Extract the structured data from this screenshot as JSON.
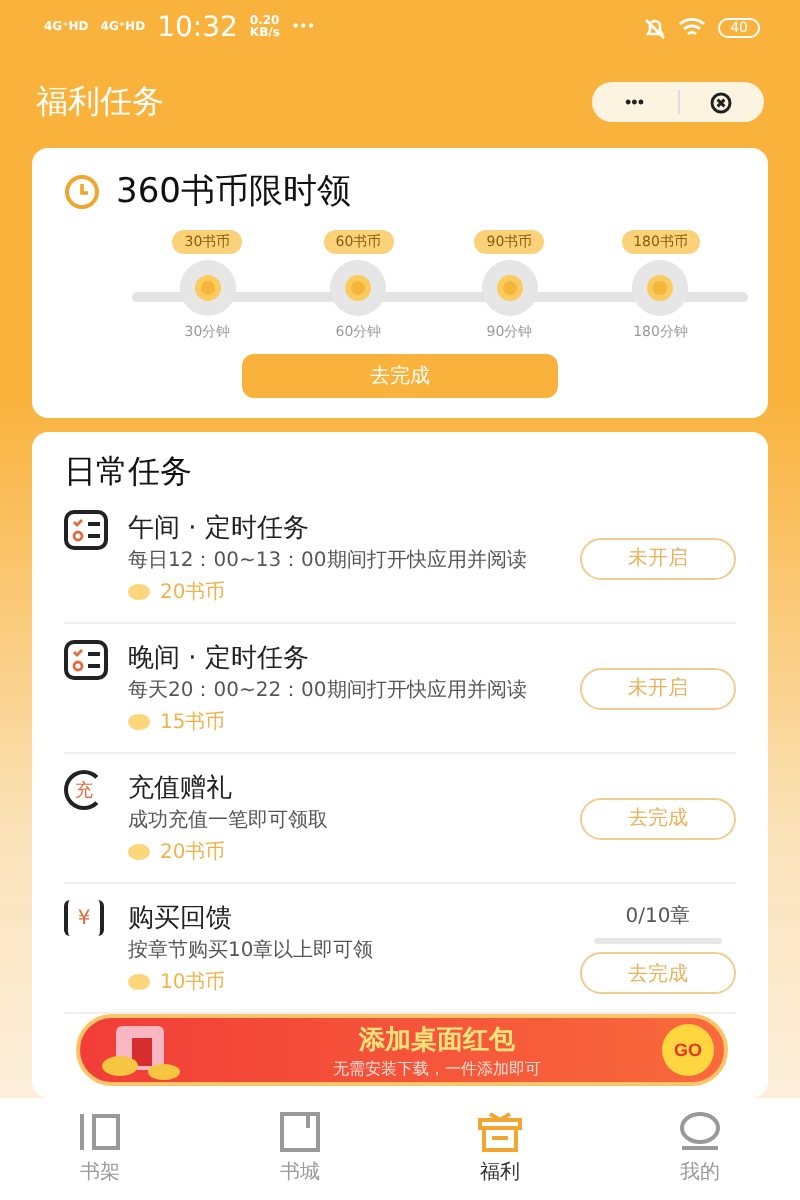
{
  "status_bar": {
    "time": "10:32",
    "speed": "0.20\nKB/s",
    "dots": "•••",
    "signal_1": "4G⁺HD",
    "signal_2": "4G⁺HD",
    "battery": "40"
  },
  "header": {
    "title": "福利任务",
    "more": "•••"
  },
  "limited": {
    "title": "360书币限时领",
    "button": "去完成",
    "milestones": [
      {
        "reward": "30书币",
        "time": "30分钟"
      },
      {
        "reward": "60书币",
        "time": "60分钟"
      },
      {
        "reward": "90书币",
        "time": "90分钟"
      },
      {
        "reward": "180书币",
        "time": "180分钟"
      }
    ]
  },
  "daily": {
    "title": "日常任务",
    "tasks": [
      {
        "kind": "schedule",
        "title": "午间 · 定时任务",
        "desc": "每日12：00~13：00期间打开快应用并阅读",
        "reward": "20书币",
        "button": "未开启"
      },
      {
        "kind": "schedule",
        "title": "晚间 · 定时任务",
        "desc": "每天20：00~22：00期间打开快应用并阅读",
        "reward": "15书币",
        "button": "未开启"
      },
      {
        "kind": "recharge",
        "title": "充值赠礼",
        "icon_text": "充",
        "desc": "成功充值一笔即可领取",
        "reward": "20书币",
        "button": "去完成"
      },
      {
        "kind": "purchase",
        "title": "购买回馈",
        "icon_text": "¥",
        "desc": "按章节购买10章以上即可领",
        "reward": "10书币",
        "button": "去完成",
        "progress": "0/10章",
        "level": 0
      }
    ]
  },
  "banner": {
    "title": "添加桌面红包",
    "subtitle": "无需安装下载，一件添加即可",
    "go": "GO"
  },
  "nav": [
    {
      "label": "书架",
      "kind": "shelf",
      "selected": false
    },
    {
      "label": "书城",
      "kind": "store",
      "selected": false
    },
    {
      "label": "福利",
      "kind": "gift",
      "selected": true
    },
    {
      "label": "我的",
      "kind": "user",
      "selected": false
    }
  ]
}
